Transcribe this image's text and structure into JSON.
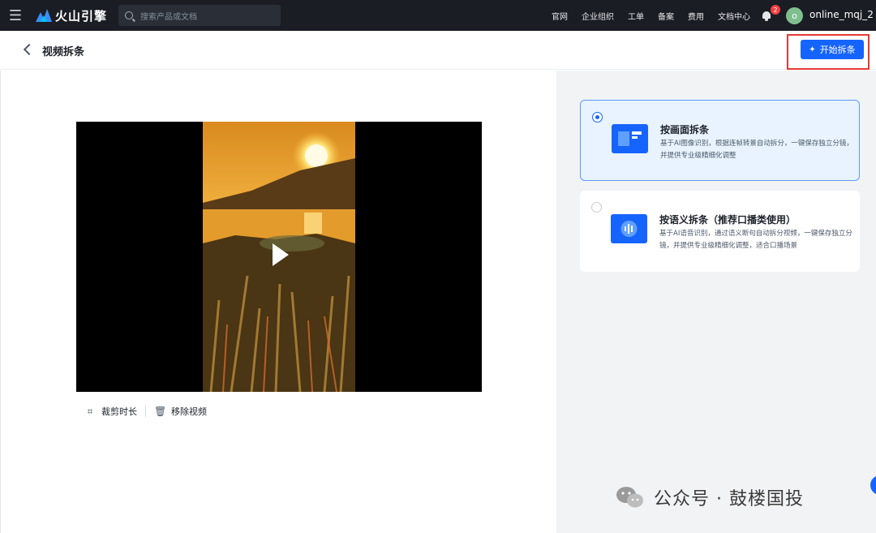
{
  "topbar": {
    "brand": "火山引擎",
    "search_placeholder": "搜索产品或文档",
    "nav_links": [
      "官网",
      "企业组织",
      "工单",
      "备案",
      "费用",
      "文档中心"
    ],
    "notification_count": "2",
    "avatar_letter": "o",
    "username": "online_mqj_2"
  },
  "header": {
    "title": "视频拆条",
    "start_button": "开始拆条"
  },
  "video": {
    "actions": {
      "trim_label": "裁剪时长",
      "remove_label": "移除视频"
    }
  },
  "options": [
    {
      "title": "按画面拆条",
      "description": "基于AI图像识别，根据连帧转景自动拆分，一键保存独立分镜，并提供专业级精细化调整",
      "selected": true
    },
    {
      "title": "按语义拆条（推荐口播类使用）",
      "description": "基于AI语音识别，通过语义断句自动拆分视频，一键保存独立分镜，并提供专业级精细化调整，适合口播场景",
      "selected": false
    }
  ],
  "footer_watermark": "公众号 · 鼓楼国投",
  "colors": {
    "accent": "#1664ff",
    "topbar": "#1a1d24",
    "highlight": "#e53935"
  }
}
